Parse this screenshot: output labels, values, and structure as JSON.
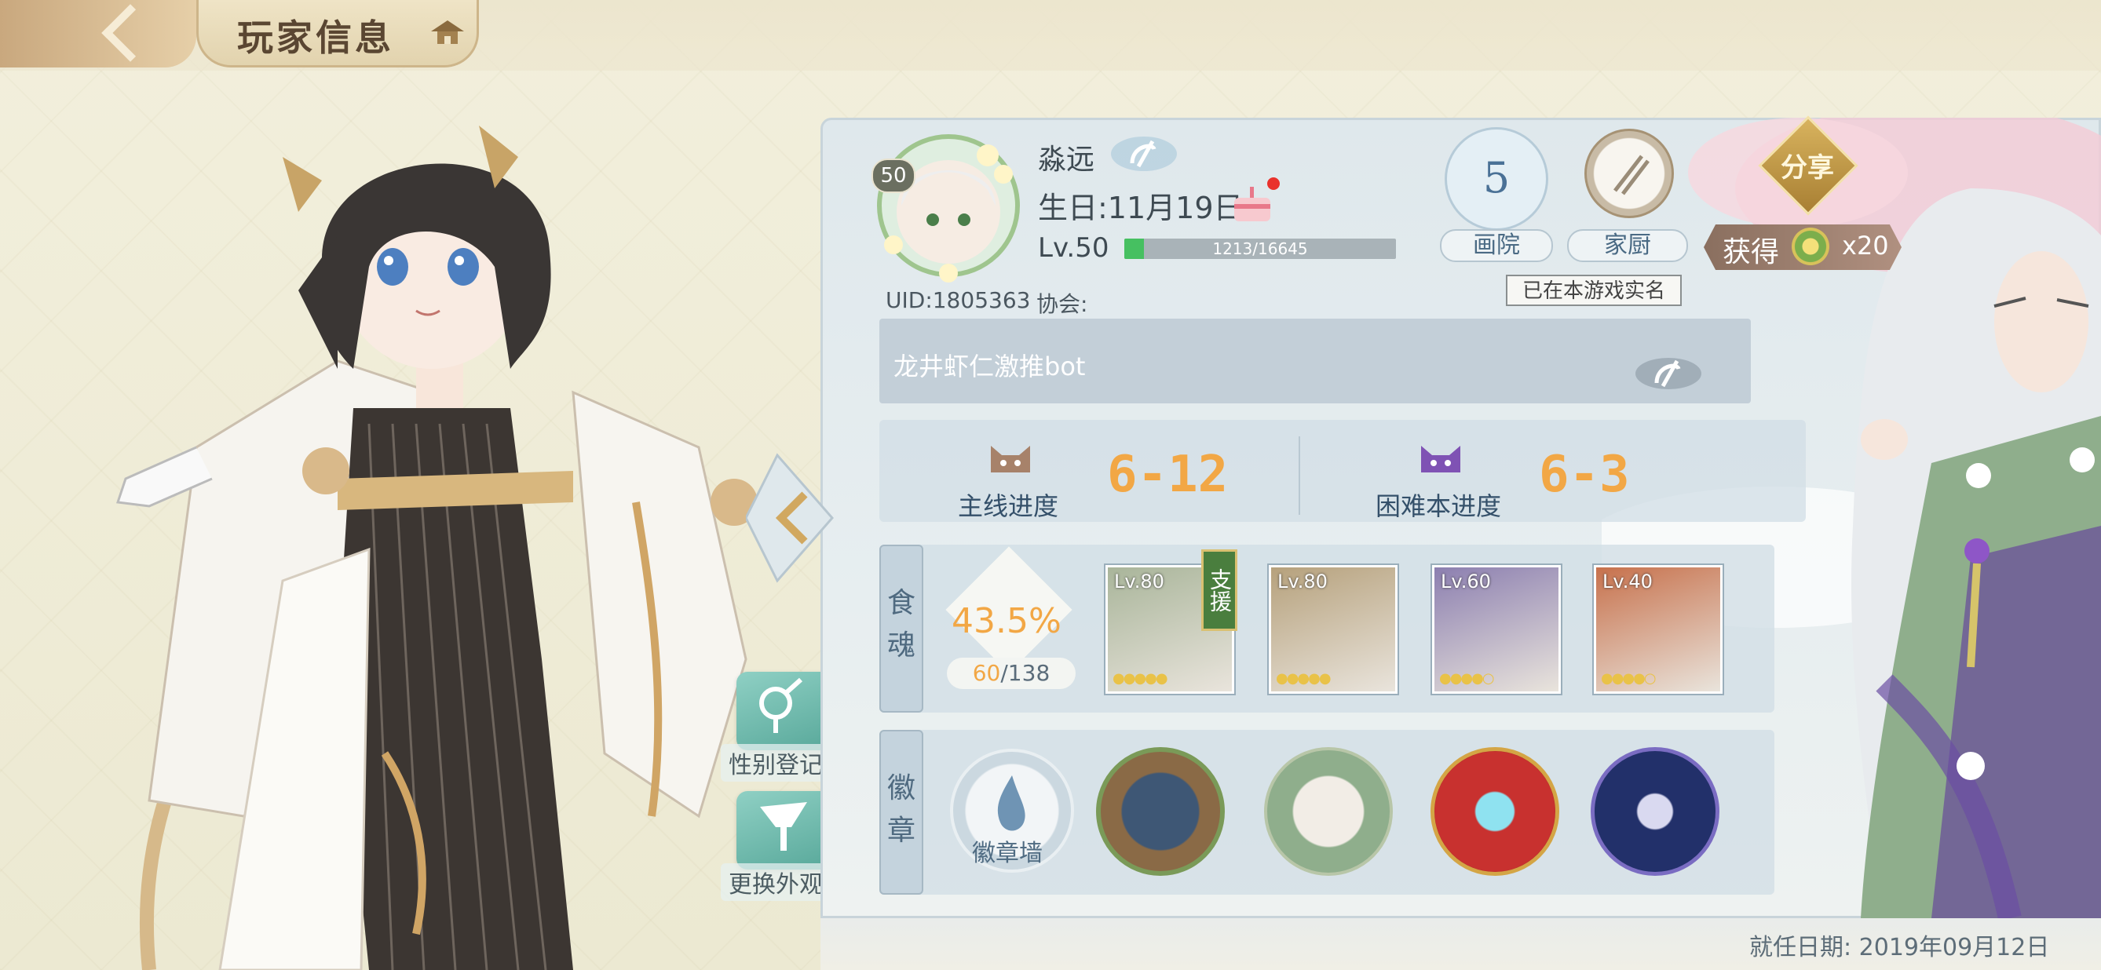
{
  "header": {
    "title": "玩家信息"
  },
  "player": {
    "name": "淼远",
    "birthday": "生日:11月19日",
    "level_label": "Lv.50",
    "avatar_level": "50",
    "exp_text": "1213/16645",
    "exp_fraction": 0.0729,
    "uid": "UID:1805363",
    "guild": "协会:",
    "signature": "龙井虾仁激推bot",
    "join_date": "就任日期:  2019年09月12日"
  },
  "actions": {
    "gallery": {
      "value": "5",
      "label": "画院"
    },
    "kitchen": {
      "label": "家厨"
    },
    "verified": "已在本游戏实名",
    "share": "分享",
    "reward_get": "获得",
    "reward_count": "x20"
  },
  "progress": {
    "main_label": "主线进度",
    "main_value": "6-12",
    "hard_label": "困难本进度",
    "hard_value": "6-3"
  },
  "souls": {
    "tag": "食魂",
    "percent": "43.5%",
    "count_owned": "60",
    "count_total": "/138",
    "support_label": "支援",
    "cards": [
      {
        "level": "Lv.80",
        "stars": "●●●●●",
        "color": "#a9b59a"
      },
      {
        "level": "Lv.80",
        "stars": "●●●●●",
        "color": "#b6a17c"
      },
      {
        "level": "Lv.60",
        "stars": "●●●●○",
        "color": "#8c7fb0"
      },
      {
        "level": "Lv.40",
        "stars": "●●●●○",
        "color": "#c7714c"
      }
    ]
  },
  "badges": {
    "tag": "徽章",
    "wall_label": "徽章墙"
  },
  "side_buttons": {
    "gender": "性别登记",
    "appearance": "更换外观"
  },
  "colors": {
    "accent_orange": "#f2a745",
    "exp_green": "#46c061",
    "panel_blue": "#dfe8ec"
  }
}
